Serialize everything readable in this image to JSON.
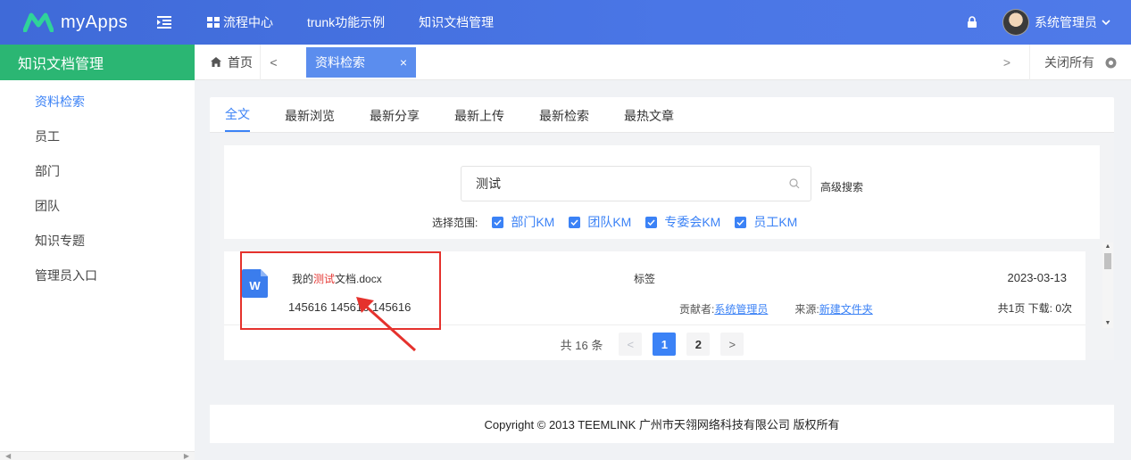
{
  "app": {
    "name": "myApps"
  },
  "top_nav": [
    {
      "label": "流程中心"
    },
    {
      "label": "trunk功能示例"
    },
    {
      "label": "知识文档管理"
    }
  ],
  "user": {
    "name": "系统管理员"
  },
  "sidebar": {
    "title": "知识文档管理",
    "items": [
      {
        "label": "资料检索"
      },
      {
        "label": "员工"
      },
      {
        "label": "部门"
      },
      {
        "label": "团队"
      },
      {
        "label": "知识专题"
      },
      {
        "label": "管理员入口"
      }
    ]
  },
  "tabbar": {
    "home_label": "首页",
    "prev": "<",
    "next": ">",
    "active_tab": "资料检索",
    "close_tab": "×",
    "close_all": "关闭所有"
  },
  "content_tabs": [
    {
      "label": "全文"
    },
    {
      "label": "最新浏览"
    },
    {
      "label": "最新分享"
    },
    {
      "label": "最新上传"
    },
    {
      "label": "最新检索"
    },
    {
      "label": "最热文章"
    }
  ],
  "search": {
    "value": "测试",
    "advanced": "高级搜索",
    "scope_label": "选择范围:",
    "scopes": [
      {
        "label": "部门KM",
        "checked": true
      },
      {
        "label": "团队KM",
        "checked": true
      },
      {
        "label": "专委会KM",
        "checked": true
      },
      {
        "label": "员工KM",
        "checked": true
      }
    ]
  },
  "result": {
    "icon_letter": "W",
    "name_prefix": "我的",
    "name_highlight": "测试",
    "name_suffix": "文档.docx",
    "description": "145616 145616 145616",
    "tag_label": "标签",
    "date": "2023-03-13",
    "contributor_label": "贡献者:",
    "contributor": "系统管理员",
    "source_label": "来源:",
    "source": "新建文件夹",
    "pages_info": "共1页  下载: 0次"
  },
  "pagination": {
    "total": "共 16 条",
    "prev": "<",
    "pages": [
      "1",
      "2"
    ],
    "next": ">"
  },
  "footer": {
    "copyright": "Copyright © 2013 TEEMLINK 广州市天翎网络科技有限公司 版权所有"
  },
  "colors": {
    "topbar": "#4a76e6",
    "sidebar_title": "#2bb673",
    "accent": "#3b82f6",
    "highlight_box": "#e5322d"
  }
}
